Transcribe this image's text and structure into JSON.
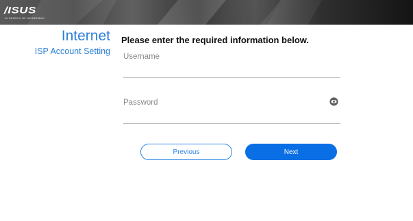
{
  "header": {
    "logo_text": "/ISUS",
    "logo_tagline": "IN SEARCH OF INCREDIBLE"
  },
  "sidebar": {
    "title": "Internet",
    "subtitle": "ISP Account Setting"
  },
  "form": {
    "heading": "Please enter the required information below.",
    "username": {
      "value": "",
      "placeholder": "Username"
    },
    "password": {
      "value": "",
      "placeholder": "Password",
      "toggle_icon": "eye-icon"
    }
  },
  "buttons": {
    "previous_label": "Previous",
    "next_label": "Next"
  },
  "colors": {
    "accent": "#2c7fd6",
    "primary_button": "#0a6fe4",
    "header_dark": "#141414"
  }
}
